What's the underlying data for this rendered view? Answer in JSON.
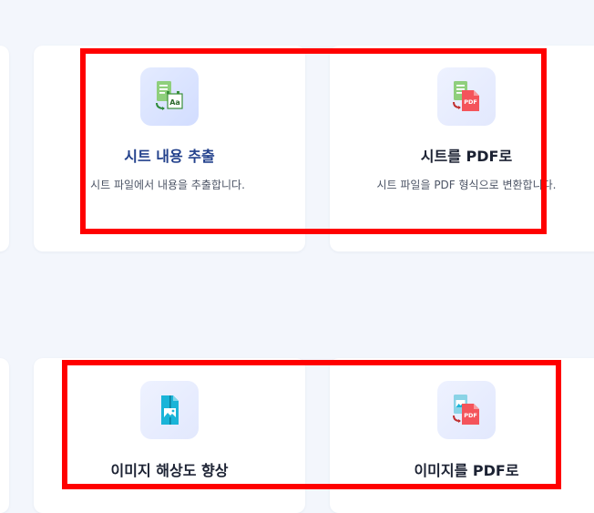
{
  "row1": {
    "left_card": {
      "title": "시트 내용 추출",
      "description": "시트 파일에서 내용을 추출합니다.",
      "icon": "sheet-extract-icon"
    },
    "right_card": {
      "title": "시트를 PDF로",
      "description": "시트 파일을 PDF 형식으로 변환합니다.",
      "icon": "sheet-to-pdf-icon",
      "icon_badge": "PDF"
    }
  },
  "row2": {
    "left_card": {
      "title": "이미지 해상도 향상",
      "icon": "image-enhance-icon"
    },
    "right_card": {
      "title": "이미지를 PDF로",
      "icon": "image-to-pdf-icon",
      "icon_badge": "PDF"
    }
  },
  "colors": {
    "highlight": "#ff0000",
    "accent_title": "#23418c",
    "sheet_green": "#4caf50",
    "pdf_red": "#f4545b",
    "image_cyan": "#1ab4d8"
  }
}
